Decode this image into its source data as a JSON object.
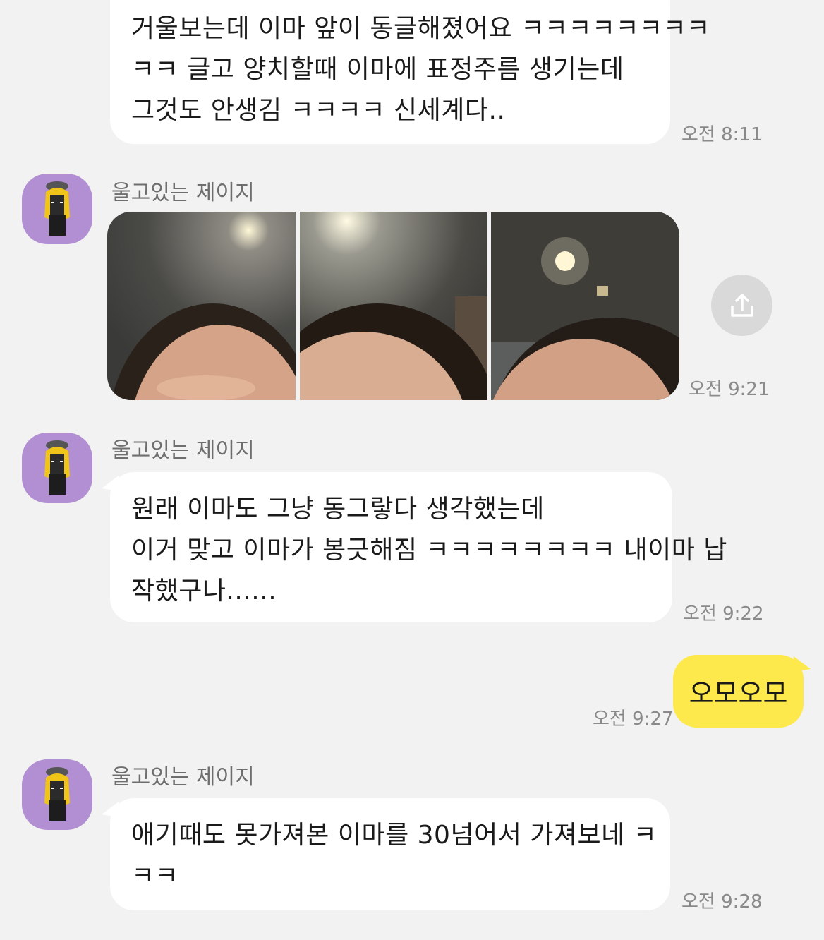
{
  "messages": {
    "m1": {
      "lines": [
        "거울보는데 이마 앞이 동글해졌어요 ㅋㅋㅋㅋㅋㅋㅋㅋ",
        "ㅋㅋ 글고 양치할때 이마에 표정주름 생기는데",
        "그것도 안생김 ㅋㅋㅋㅋ 신세계다.."
      ],
      "time": "오전 8:11"
    },
    "m2": {
      "sender": "울고있는 제이지",
      "time": "오전 9:21",
      "photo_count": 3
    },
    "m3": {
      "sender": "울고있는 제이지",
      "lines": [
        "원래 이마도 그냥 동그랗다 생각했는데",
        "이거 맞고 이마가 봉긋해짐 ㅋㅋㅋㅋㅋㅋㅋㅋ 내이마 납",
        "작했구나......"
      ],
      "time": "오전 9:22"
    },
    "m4": {
      "text": "오모오모",
      "time": "오전 9:27"
    },
    "m5": {
      "sender": "울고있는 제이지",
      "lines": [
        "애기때도 못가져본 이마를 30넘어서 가져보네 ㅋ",
        "ㅋㅋ"
      ],
      "time": "오전 9:28"
    }
  },
  "icons": {
    "share": "share-icon",
    "avatar": "kakao-jay-g-avatar"
  },
  "colors": {
    "background": "#f2f2f2",
    "incoming_bubble": "#ffffff",
    "outgoing_bubble": "#fee94c",
    "avatar_bg": "#b18fd2"
  }
}
